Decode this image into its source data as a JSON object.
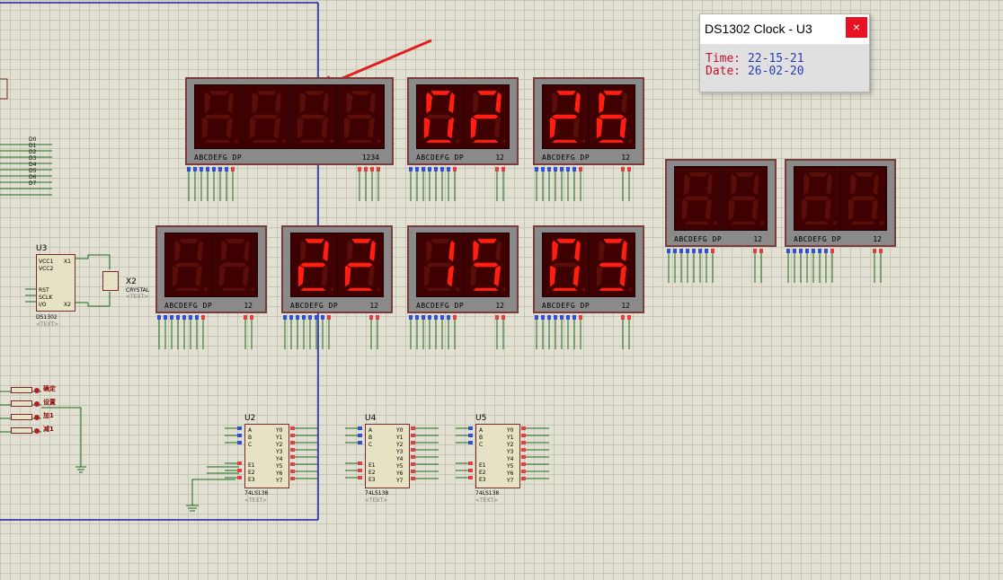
{
  "popup": {
    "title": "DS1302 Clock - U3",
    "close_glyph": "×",
    "time_label": "Time:",
    "time_value": "22-15-21",
    "date_label": "Date:",
    "date_value": "26-02-20"
  },
  "displays": [
    {
      "digits": "8888",
      "lit": false,
      "pins": "ABCDEFG  DP",
      "num": "1234"
    },
    {
      "digits": "02",
      "lit": true,
      "pins": "ABCDEFG  DP",
      "num": "12"
    },
    {
      "digits": "26",
      "lit": true,
      "pins": "ABCDEFG  DP",
      "num": "12"
    },
    {
      "digits": "88",
      "lit": false,
      "pins": "ABCDEFG  DP",
      "num": "12"
    },
    {
      "digits": "88",
      "lit": false,
      "pins": "ABCDEFG  DP",
      "num": "12"
    },
    {
      "digits": "88",
      "lit": false,
      "pins": "ABCDEFG  DP",
      "num": "12"
    },
    {
      "digits": "22",
      "lit": true,
      "pins": "ABCDEFG  DP",
      "num": "12"
    },
    {
      "digits": "15",
      "lit": true,
      "pins": "ABCDEFG  DP",
      "num": "12"
    },
    {
      "digits": "03",
      "lit": true,
      "pins": "ABCDEFG  DP",
      "num": "12"
    }
  ],
  "ds1302": {
    "ref": "U3",
    "part": "DS1302",
    "pins_left": [
      "VCC1",
      "VCC2",
      "RST",
      "SCLK",
      "I/O"
    ],
    "pins_right": [
      "X1",
      "X2"
    ],
    "text": "<TEXT>"
  },
  "crystal": {
    "ref": "X2",
    "part": "CRYSTAL",
    "text": "<TEXT>"
  },
  "decoders": [
    {
      "ref": "U2",
      "part": "74LS138",
      "text": "<TEXT>"
    },
    {
      "ref": "U4",
      "part": "74LS138",
      "text": "<TEXT>"
    },
    {
      "ref": "U5",
      "part": "74LS138",
      "text": "<TEXT>"
    }
  ],
  "decoder_pins": {
    "left": [
      "A",
      "B",
      "C",
      "E1",
      "E2",
      "E3"
    ],
    "right": [
      "Y0",
      "Y1",
      "Y2",
      "Y3",
      "Y4",
      "Y5",
      "Y6",
      "Y7"
    ]
  },
  "bus_labels": [
    "D0",
    "D1",
    "D2",
    "D3",
    "D4",
    "D5",
    "D6",
    "D7"
  ],
  "buttons": [
    "确定",
    "设置",
    "加1",
    "减1"
  ],
  "colors": {
    "segment_on": "#ff1e10",
    "segment_off": "#5a0e0a",
    "wire": "#1a6b1a",
    "bus": "#1f1fb0"
  }
}
